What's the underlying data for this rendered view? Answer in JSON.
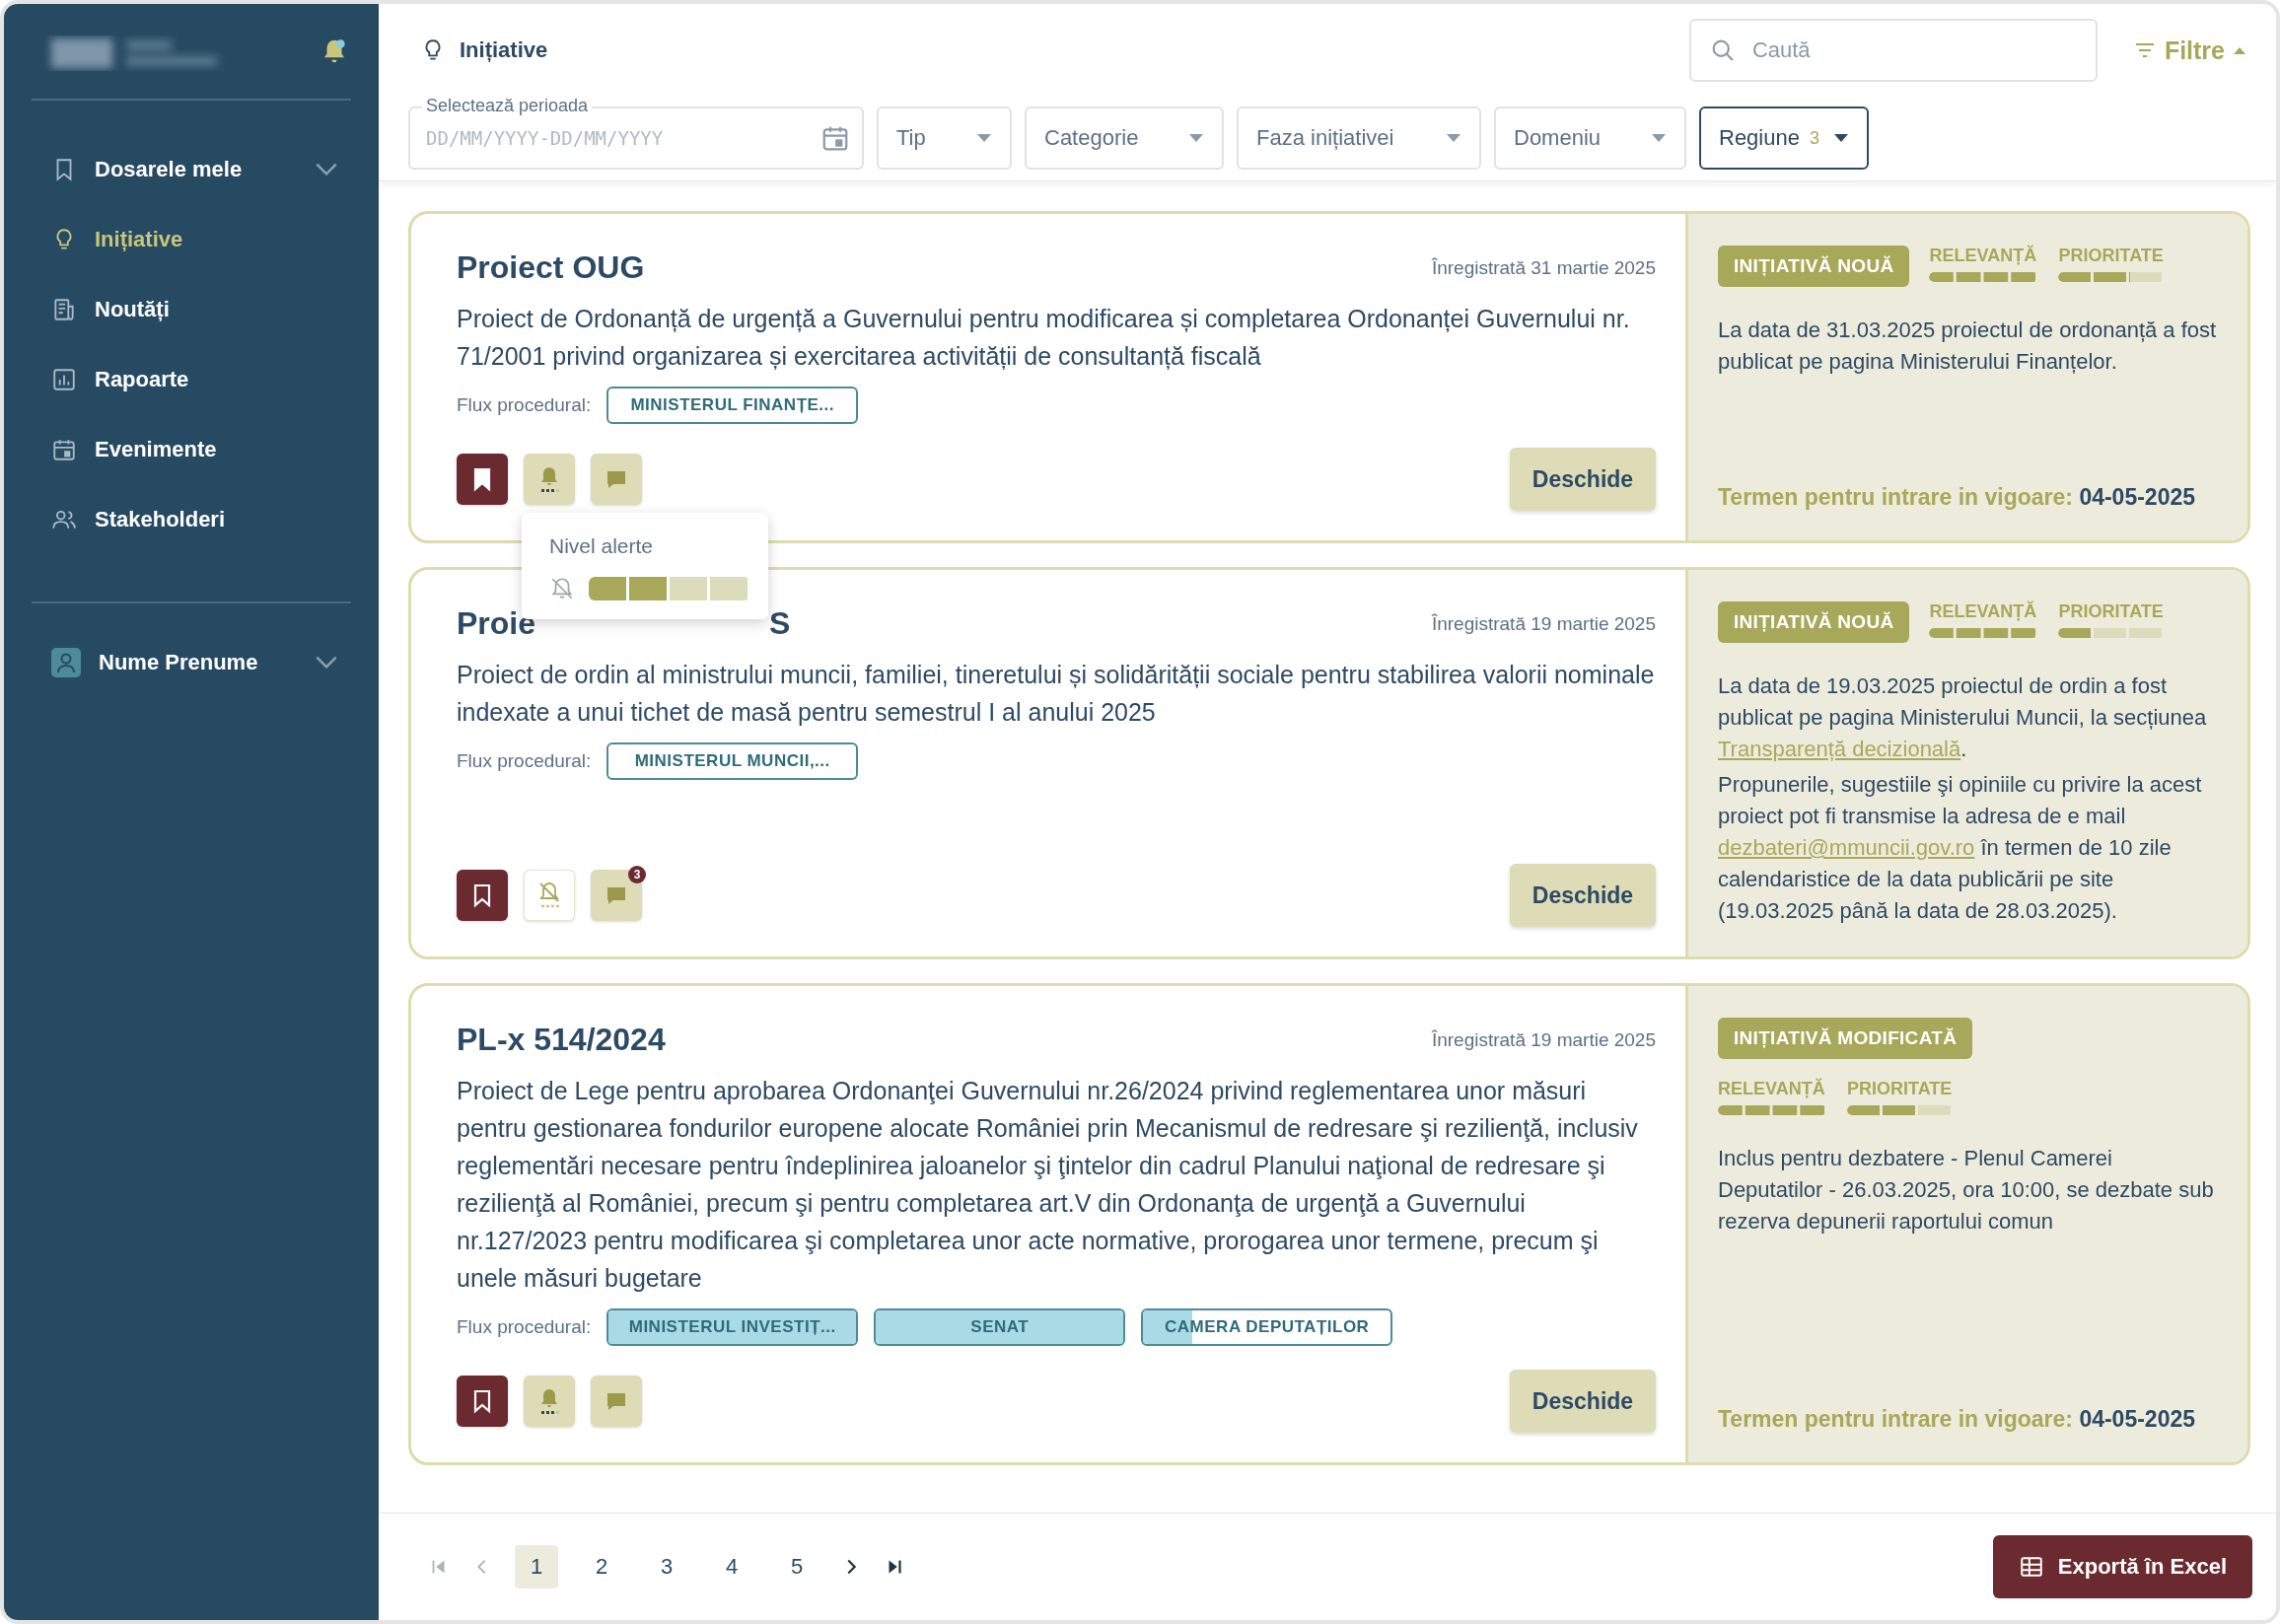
{
  "sidebar": {
    "items": [
      {
        "label": "Dosarele mele",
        "selected": false,
        "expandable": true
      },
      {
        "label": "Inițiative",
        "selected": true,
        "expandable": false
      },
      {
        "label": "Noutăți",
        "selected": false,
        "expandable": false
      },
      {
        "label": "Rapoarte",
        "selected": false,
        "expandable": false
      },
      {
        "label": "Evenimente",
        "selected": false,
        "expandable": false
      },
      {
        "label": "Stakeholderi",
        "selected": false,
        "expandable": false
      }
    ],
    "user": {
      "name": "Nume Prenume"
    }
  },
  "header": {
    "title": "Inițiative",
    "search": {
      "placeholder": "Caută"
    },
    "filters_button": "Filtre",
    "date_field": {
      "label": "Selectează perioada",
      "placeholder": "DD/MM/YYYY-DD/MM/YYYY"
    },
    "dropdowns": [
      {
        "label": "Tip",
        "active": false
      },
      {
        "label": "Categorie",
        "active": false
      },
      {
        "label": "Faza inițiativei",
        "active": false
      },
      {
        "label": "Domeniu",
        "active": false
      },
      {
        "label": "Regiune",
        "count": "3",
        "active": true
      }
    ]
  },
  "cards": [
    {
      "title": "Proiect OUG",
      "registered": "Înregistrată 31 martie 2025",
      "description": "Proiect de Ordonanță de urgență a Guvernului pentru modificarea și completarea Ordonanței Guvernului nr. 71/2001 privind organizarea și exercitarea activității de consultanță fiscală",
      "flux_label": "Flux procedural:",
      "tags": [
        {
          "label": "MINISTERUL FINANȚE..."
        }
      ],
      "bookmarked": true,
      "alerts_on": true,
      "open_label": "Deschide",
      "alert_popover": {
        "title": "Nivel alerte",
        "level": 0.5
      },
      "status_badge": "INIȚIATIVĂ NOUĂ",
      "levels": [
        {
          "kind": "relevance",
          "label": "RELEVANȚĂ",
          "level": 1
        },
        {
          "kind": "priority",
          "label": "PRIORITATE",
          "level": 0.667
        }
      ],
      "notes": [
        [
          {
            "text": "La data de 31.03.2025 proiectul de ordonanță a fost publicat pe pagina Ministerului Finanțelor.",
            "kind": "text"
          }
        ]
      ],
      "deadline": {
        "label": "Termen pentru intrare in vigoare:",
        "value": "04-05-2025"
      }
    },
    {
      "title": "Proie",
      "title_tail": "S",
      "registered": "Înregistrată 19 martie 2025",
      "description": "Proiect de ordin al ministrului muncii, familiei, tineretului și solidărității sociale pentru stabilirea valorii nominale indexate a unui tichet de masă pentru semestrul I al anului 2025",
      "flux_label": "Flux procedural:",
      "tags": [
        {
          "label": "MINISTERUL MUNCII,..."
        }
      ],
      "bookmarked": false,
      "alerts_on": false,
      "comment_count": "3",
      "open_label": "Deschide",
      "status_badge": "INIȚIATIVĂ NOUĂ",
      "levels": [
        {
          "kind": "relevance",
          "label": "RELEVANȚĂ",
          "level": 1
        },
        {
          "kind": "priority",
          "label": "PRIORITATE",
          "level": 0.333
        }
      ],
      "notes": [
        [
          {
            "text": "La data de 19.03.2025 proiectul de ordin a fost publicat pe pagina Ministerului Muncii, la secțiunea ",
            "kind": "text"
          },
          {
            "text": "Transparență decizională",
            "kind": "link"
          },
          {
            "text": ".",
            "kind": "text"
          }
        ],
        [
          {
            "text": "Propunerile, sugestiile şi opiniile cu privire la acest proiect pot fi transmise la adresa de e mail ",
            "kind": "text"
          },
          {
            "text": "dezbateri@mmuncii.gov.ro",
            "kind": "link"
          },
          {
            "text": " în termen de 10 zile calendaristice de la data publicării pe site (19.03.2025 până la data de 28.03.2025).",
            "kind": "text"
          }
        ]
      ]
    },
    {
      "title": "PL-x 514/2024",
      "registered": "Înregistrată 19 martie 2025",
      "description": "Proiect de Lege pentru aprobarea Ordonanţei Guvernului nr.26/2024 privind reglementarea unor măsuri pentru gestionarea fondurilor europene alocate României prin Mecanismul de redresare şi rezilienţă, inclusiv reglementări necesare pentru îndeplinirea jaloanelor şi ţintelor din cadrul Planului naţional de redresare şi rezilienţă al României, precum şi pentru completarea art.V din Ordonanţa de urgenţă a Guvernului nr.127/2023 pentru modificarea şi completarea unor acte normative, prorogarea unor termene, precum şi unele măsuri bugetare",
      "flux_label": "Flux procedural:",
      "tags": [
        {
          "label": "MINISTERUL INVESTIȚ...",
          "level": 1
        },
        {
          "label": "SENAT",
          "level": 1
        },
        {
          "label": "CAMERA DEPUTAȚILOR",
          "level": 0.2
        }
      ],
      "bookmarked": false,
      "alerts_on": true,
      "open_label": "Deschide",
      "status_badge": "INIȚIATIVĂ MODIFICATĂ",
      "levels": [
        {
          "kind": "relevance",
          "label": "RELEVANȚĂ",
          "level": 1
        },
        {
          "kind": "priority",
          "label": "PRIORITATE",
          "level": 0.667
        }
      ],
      "notes": [
        [
          {
            "text": "Inclus pentru dezbatere - Plenul Camerei Deputatilor - 26.03.2025, ora 10:00, se dezbate sub rezerva depunerii raportului comun",
            "kind": "text"
          }
        ]
      ],
      "deadline": {
        "label": "Termen pentru intrare in vigoare:",
        "value": "04-05-2025"
      }
    }
  ],
  "pagination": {
    "pages": [
      {
        "label": "1",
        "selected": true
      },
      {
        "label": "2",
        "selected": false
      },
      {
        "label": "3",
        "selected": false
      },
      {
        "label": "4",
        "selected": false
      },
      {
        "label": "5",
        "selected": false
      }
    ]
  },
  "export_button": "Exportă în Excel"
}
